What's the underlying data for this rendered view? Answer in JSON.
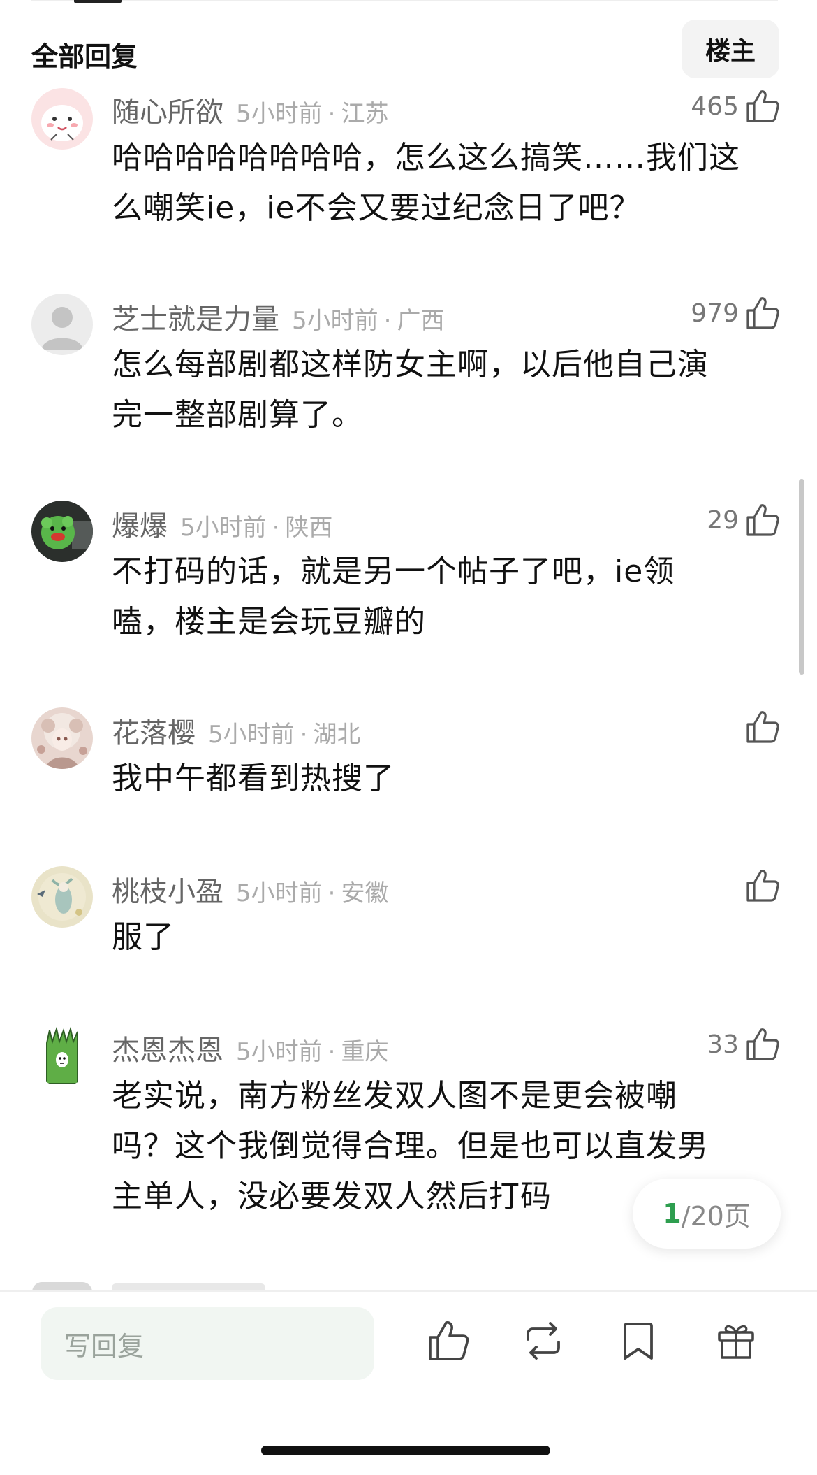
{
  "header": {
    "title": "全部回复",
    "op_button": "楼主"
  },
  "comments": [
    {
      "user": "随心所欲",
      "time": "5小时前",
      "location": "江苏",
      "likes": "465",
      "lines": [
        "哈哈哈哈哈哈哈哈，怎么这么搞笑……我们这",
        "么嘲笑ie，ie不会又要过纪念日了吧？"
      ]
    },
    {
      "user": "芝士就是力量",
      "time": "5小时前",
      "location": "广西",
      "likes": "979",
      "lines": [
        "怎么每部剧都这样防女主啊，以后他自己演",
        "完一整部剧算了。"
      ]
    },
    {
      "user": "爆爆",
      "time": "5小时前",
      "location": "陕西",
      "likes": "29",
      "lines": [
        "不打码的话，就是另一个帖子了吧，ie领",
        "嗑，楼主是会玩豆瓣的"
      ]
    },
    {
      "user": "花落樱",
      "time": "5小时前",
      "location": "湖北",
      "likes": "",
      "lines": [
        "我中午都看到热搜了"
      ]
    },
    {
      "user": "桃枝小盈",
      "time": "5小时前",
      "location": "安徽",
      "likes": "",
      "lines": [
        "服了"
      ]
    },
    {
      "user": "杰恩杰恩",
      "time": "5小时前",
      "location": "重庆",
      "likes": "33",
      "lines": [
        "老实说，南方粉丝发双人图不是更会被嘲",
        "吗？这个我倒觉得合理。但是也可以直发男",
        "主单人，没必要发双人然后打码"
      ]
    }
  ],
  "pagination": {
    "current": "1",
    "total": "/20页"
  },
  "bottom_bar": {
    "reply_placeholder": "写回复",
    "actions": [
      "like-icon",
      "repost-icon",
      "bookmark-icon",
      "gift-icon"
    ]
  },
  "colors": {
    "accent_green": "#2e9e4f",
    "input_bg": "#f1f6f2"
  }
}
